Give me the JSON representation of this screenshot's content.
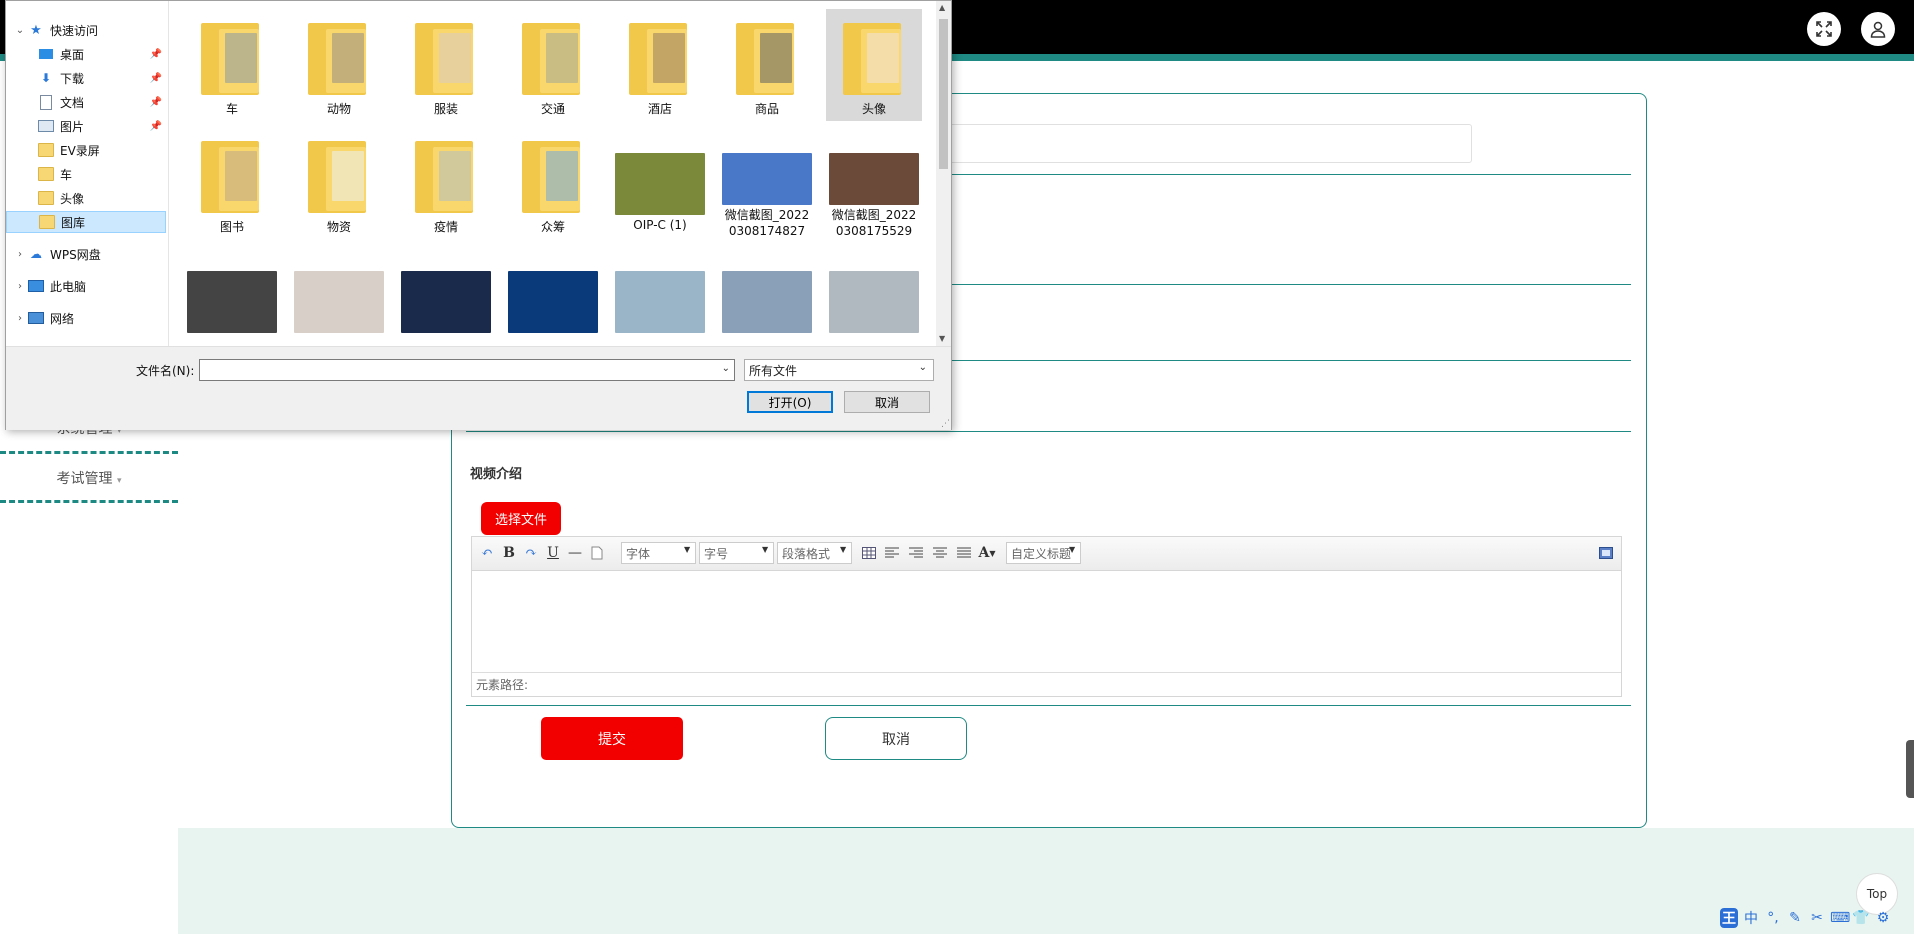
{
  "sidebar": {
    "items": [
      {
        "label": "系统管理"
      },
      {
        "label": "考试管理"
      }
    ]
  },
  "form": {
    "video_intro_label": "视频介绍",
    "choose_file_label": "选择文件",
    "submit_label": "提交",
    "cancel_label": "取消"
  },
  "editor": {
    "toolbar": {
      "font_family": "字体",
      "font_size": "字号",
      "paragraph_format": "段落格式",
      "custom_heading": "自定义标题"
    },
    "element_path_label": "元素路径:"
  },
  "page": {
    "top_button_label": "Top"
  },
  "file_dialog": {
    "nav": {
      "quick_access": "快速访问",
      "items": [
        {
          "label": "桌面",
          "pinned": true
        },
        {
          "label": "下载",
          "pinned": true
        },
        {
          "label": "文档",
          "pinned": true
        },
        {
          "label": "图片",
          "pinned": true
        },
        {
          "label": "EV录屏"
        },
        {
          "label": "车"
        },
        {
          "label": "头像"
        },
        {
          "label": "图库",
          "selected": true
        }
      ],
      "wps_cloud": "WPS网盘",
      "this_pc": "此电脑",
      "network": "网络"
    },
    "files": [
      {
        "label": "车",
        "type": "folder",
        "color": "#6a7d8c"
      },
      {
        "label": "动物",
        "type": "folder",
        "color": "#7b6f66"
      },
      {
        "label": "服装",
        "type": "folder",
        "color": "#c9b8b0"
      },
      {
        "label": "交通",
        "type": "folder",
        "color": "#8a8f7a"
      },
      {
        "label": "酒店",
        "type": "folder",
        "color": "#7a5a3a"
      },
      {
        "label": "商品",
        "type": "folder",
        "color": "#3a3a3a"
      },
      {
        "label": "头像",
        "type": "folder",
        "color": "#e8d6d0",
        "selected": true
      },
      {
        "label": "图书",
        "type": "folder",
        "color": "#a88d6b"
      },
      {
        "label": "物资",
        "type": "folder",
        "color": "#dfe7ea"
      },
      {
        "label": "疫情",
        "type": "folder",
        "color": "#9aa6b2"
      },
      {
        "label": "众筹",
        "type": "folder",
        "color": "#4b8fcf"
      },
      {
        "label": "OIP-C (1)",
        "type": "image",
        "color": "#7a8a3a"
      },
      {
        "label": "微信截图_20220308174827",
        "type": "image",
        "color": "#4a78c8"
      },
      {
        "label": "微信截图_20220308175529",
        "type": "image",
        "color": "#6b4a3a"
      },
      {
        "label": "",
        "type": "image",
        "color": "#444444"
      },
      {
        "label": "",
        "type": "image",
        "color": "#d8d0c8"
      },
      {
        "label": "",
        "type": "image",
        "color": "#1a2a4a"
      },
      {
        "label": "",
        "type": "image",
        "color": "#0a3a7a"
      },
      {
        "label": "",
        "type": "image",
        "color": "#9ab4c8"
      },
      {
        "label": "",
        "type": "image",
        "color": "#8aa0b8"
      },
      {
        "label": "",
        "type": "image",
        "color": "#b0b8c0"
      }
    ],
    "filename_label": "文件名(N):",
    "filename_value": "",
    "filter_value": "所有文件",
    "open_label": "打开(O)",
    "cancel_label": "取消"
  },
  "ime": {
    "items": [
      "王",
      "中",
      "°,",
      "✎",
      "✂",
      "⌨",
      "👕",
      "⚙"
    ]
  }
}
